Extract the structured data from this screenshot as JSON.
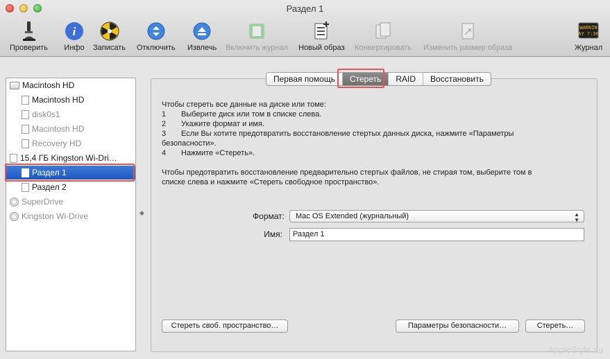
{
  "window": {
    "title": "Раздел 1"
  },
  "toolbar": {
    "verify": "Проверить",
    "info": "Инфо",
    "burn": "Записать",
    "unmount": "Отключить",
    "eject": "Извлечь",
    "enable_journal": "Включить журнал",
    "new_image": "Новый образ",
    "convert": "Конвертировать",
    "resize_image": "Изменить размер образа",
    "log": "Журнал",
    "log_icon_text": "WARNIN\nAY 7:36"
  },
  "sidebar": {
    "items": [
      {
        "label": "Macintosh HD"
      },
      {
        "label": "Macintosh HD"
      },
      {
        "label": "disk0s1"
      },
      {
        "label": "Macintosh HD"
      },
      {
        "label": "Recovery HD"
      },
      {
        "label": "15,4 ГБ Kingston Wi-Dri…"
      },
      {
        "label": "Раздел 1"
      },
      {
        "label": "Раздел 2"
      },
      {
        "label": "SuperDrive"
      },
      {
        "label": "Kingston Wi-Drive"
      }
    ]
  },
  "tabs": [
    "Первая помощь",
    "Стереть",
    "RAID",
    "Восстановить"
  ],
  "instructions": {
    "intro": "Чтобы стереть все данные на диске или томе:",
    "steps": [
      {
        "num": "1",
        "text": "Выберите диск или том в списке слева."
      },
      {
        "num": "2",
        "text": "Укажите формат и имя."
      },
      {
        "num": "3",
        "text": "Если Вы хотите предотвратить восстановление стертых данных диска, нажмите «Параметры"
      },
      {
        "num": "",
        "text": "безопасности»."
      },
      {
        "num": "4",
        "text": "Нажмите «Стереть»."
      }
    ],
    "free_space_line1": "Чтобы предотвратить восстановление предварительно стертых файлов, не стирая том, выберите том в",
    "free_space_line2": "списке слева и нажмите «Стереть свободное пространство»."
  },
  "form": {
    "format_label": "Формат:",
    "format_value": "Mac OS Extended (журнальный)",
    "name_label": "Имя:",
    "name_value": "Раздел 1"
  },
  "buttons": {
    "erase_free_space": "Стереть своб. пространство…",
    "security_options": "Параметры безопасности…",
    "erase": "Стереть…"
  },
  "watermark": "AppleStyle.su",
  "colors": {
    "selection": "#2f6ad0",
    "highlight": "#e05555"
  }
}
